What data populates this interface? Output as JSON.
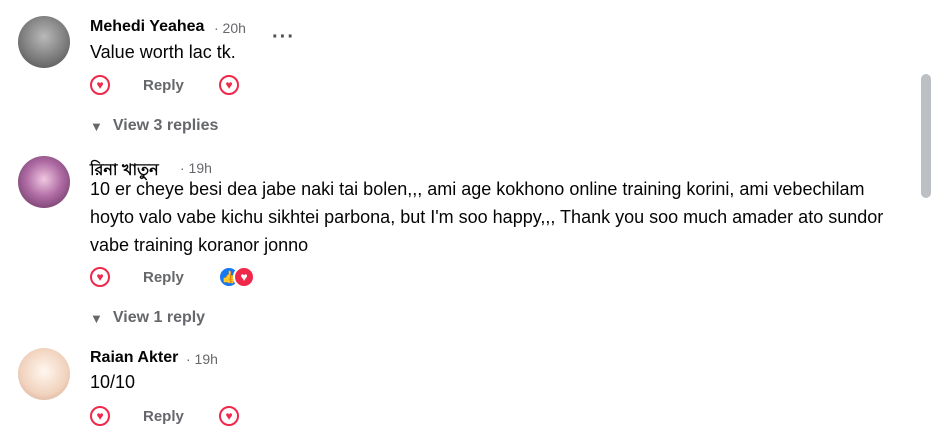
{
  "comments": [
    {
      "author": "Mehedi Yeahea",
      "time": "· 20h",
      "text": "Value worth lac tk.",
      "reply_label": "Reply",
      "view_replies": "View 3 replies",
      "more_label": "···"
    },
    {
      "author": "রিনা খাতুন",
      "time": "· 19h",
      "text": "10 er cheye besi dea jabe naki tai bolen,,, ami age kokhono online training korini, ami vebechilam hoyto valo vabe kichu sikhtei parbona, but I'm soo happy,,, Thank you soo much amader ato sundor vabe training koranor jonno",
      "reply_label": "Reply",
      "view_replies": "View 1 reply"
    },
    {
      "author": "Raian Akter",
      "time": "· 19h",
      "text": "10/10",
      "reply_label": "Reply"
    }
  ],
  "colors": {
    "love": "#f0284a",
    "like": "#1877f2",
    "secondary_text": "#65676b"
  }
}
